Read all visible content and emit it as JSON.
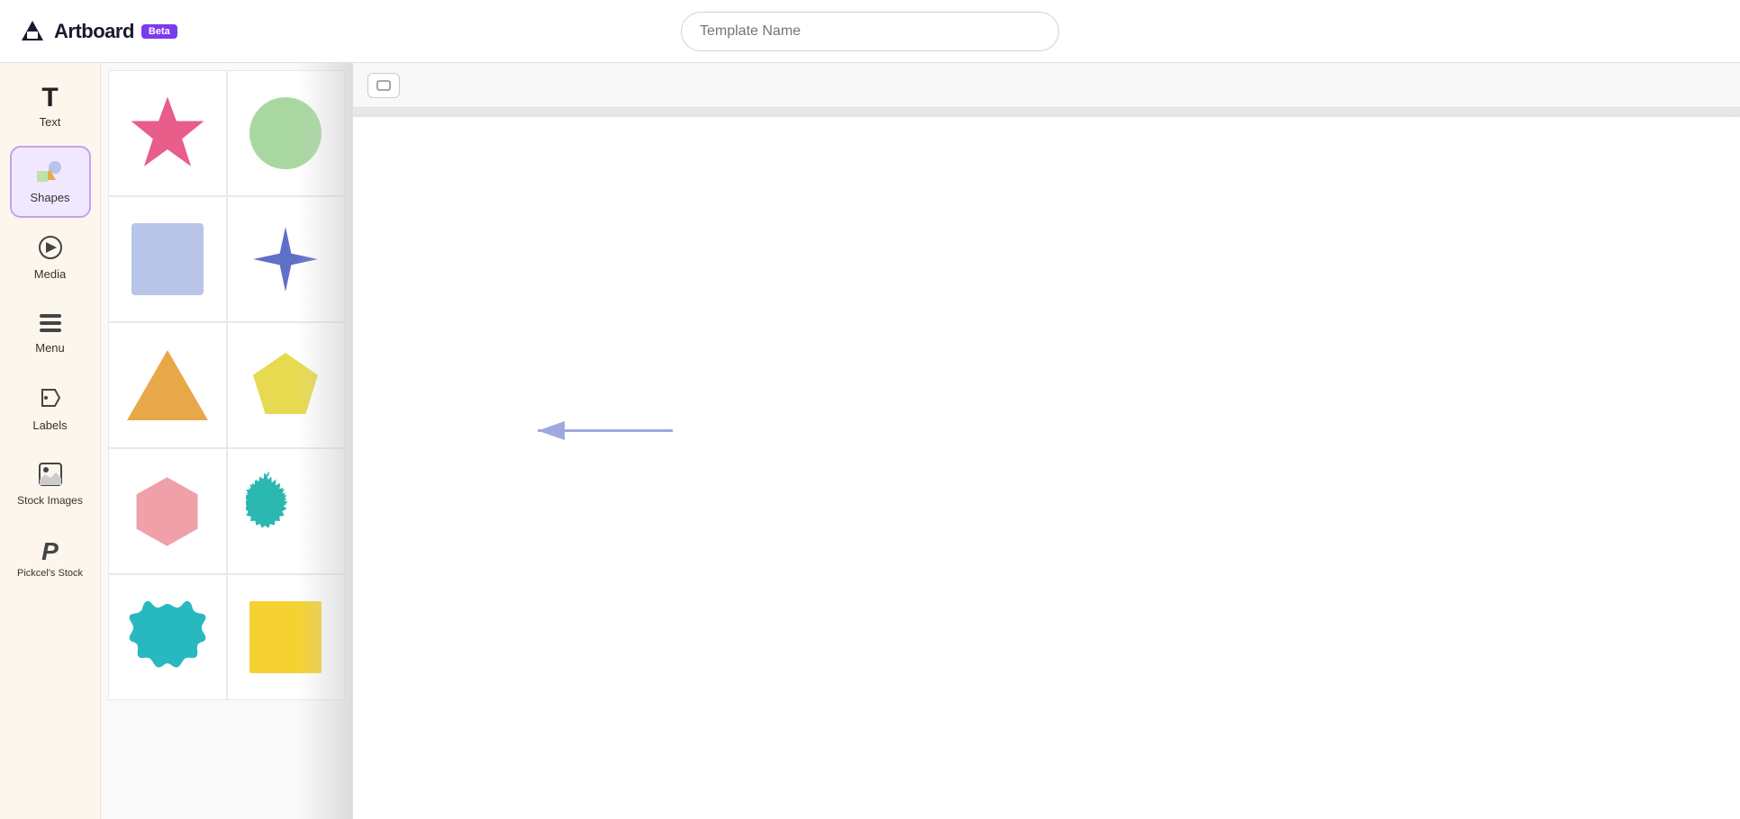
{
  "header": {
    "logo_text": "Artboard",
    "beta_label": "Beta",
    "template_placeholder": "Template Name"
  },
  "sidebar": {
    "tools": [
      {
        "id": "text",
        "label": "Text",
        "icon": "T",
        "active": false
      },
      {
        "id": "shapes",
        "label": "Shapes",
        "icon": "shapes",
        "active": true
      },
      {
        "id": "media",
        "label": "Media",
        "icon": "media",
        "active": false
      },
      {
        "id": "menu",
        "label": "Menu",
        "icon": "menu",
        "active": false
      },
      {
        "id": "labels",
        "label": "Labels",
        "icon": "labels",
        "active": false
      },
      {
        "id": "stock-images",
        "label": "Stock Images",
        "icon": "stock",
        "active": false
      },
      {
        "id": "pickcel-stock",
        "label": "Pickcel's Stock",
        "icon": "pickcel",
        "active": false
      }
    ]
  },
  "shapes_panel": {
    "shapes": [
      {
        "id": "star-pink",
        "color": "#e85d8a",
        "type": "star"
      },
      {
        "id": "circle-green",
        "color": "#a8d8a0",
        "type": "circle"
      },
      {
        "id": "square-blue",
        "color": "#b8c4e8",
        "type": "square"
      },
      {
        "id": "plus-star-blue",
        "color": "#6070c8",
        "type": "plus-star"
      },
      {
        "id": "triangle-orange",
        "color": "#e8a84a",
        "type": "triangle"
      },
      {
        "id": "pentagon-yellow",
        "color": "#e8da50",
        "type": "pentagon"
      },
      {
        "id": "hexagon-pink",
        "color": "#f0a0a8",
        "type": "hexagon"
      },
      {
        "id": "starburst-teal",
        "color": "#2ab8b0",
        "type": "starburst"
      },
      {
        "id": "rosette-teal",
        "color": "#28b8c0",
        "type": "rosette"
      },
      {
        "id": "square-yellow",
        "color": "#f5d232",
        "type": "square"
      }
    ]
  },
  "canvas": {
    "arrow_color": "#a0a8e0"
  }
}
